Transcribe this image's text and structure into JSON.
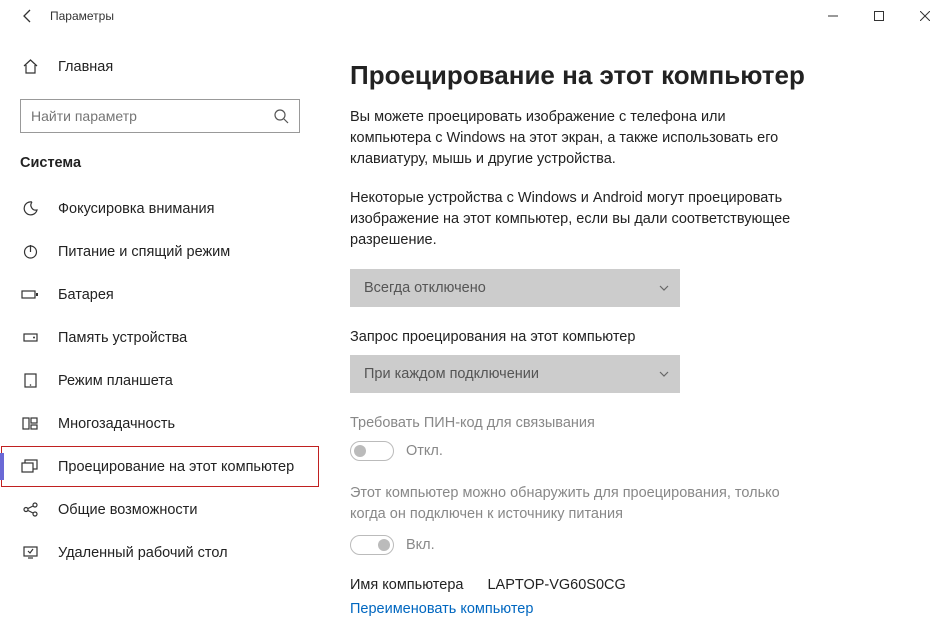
{
  "window": {
    "title": "Параметры"
  },
  "sidebar": {
    "home": "Главная",
    "search_placeholder": "Найти параметр",
    "section": "Система",
    "items": [
      {
        "label": "Фокусировка внимания"
      },
      {
        "label": "Питание и спящий режим"
      },
      {
        "label": "Батарея"
      },
      {
        "label": "Память устройства"
      },
      {
        "label": "Режим планшета"
      },
      {
        "label": "Многозадачность"
      },
      {
        "label": "Проецирование на этот компьютер"
      },
      {
        "label": "Общие возможности"
      },
      {
        "label": "Удаленный рабочий стол"
      }
    ]
  },
  "main": {
    "heading": "Проецирование на этот компьютер",
    "intro": "Вы можете проецировать изображение с телефона или компьютера с Windows на этот экран, а также использовать его клавиатуру, мышь и другие устройства.",
    "perm_text": "Некоторые устройства с Windows и Android могут проецировать изображение на этот компьютер, если вы дали соответствующее разрешение.",
    "dd1": "Всегда отключено",
    "request_label": "Запрос проецирования на этот компьютер",
    "dd2": "При каждом подключении",
    "pin_label": "Требовать ПИН-код для связывания",
    "pin_state": "Откл.",
    "discover_text": "Этот компьютер можно обнаружить для проецирования, только когда он подключен к источнику питания",
    "discover_state": "Вкл.",
    "pcname_label": "Имя компьютера",
    "pcname_value": "LAPTOP-VG60S0CG",
    "rename_link": "Переименовать компьютер"
  }
}
